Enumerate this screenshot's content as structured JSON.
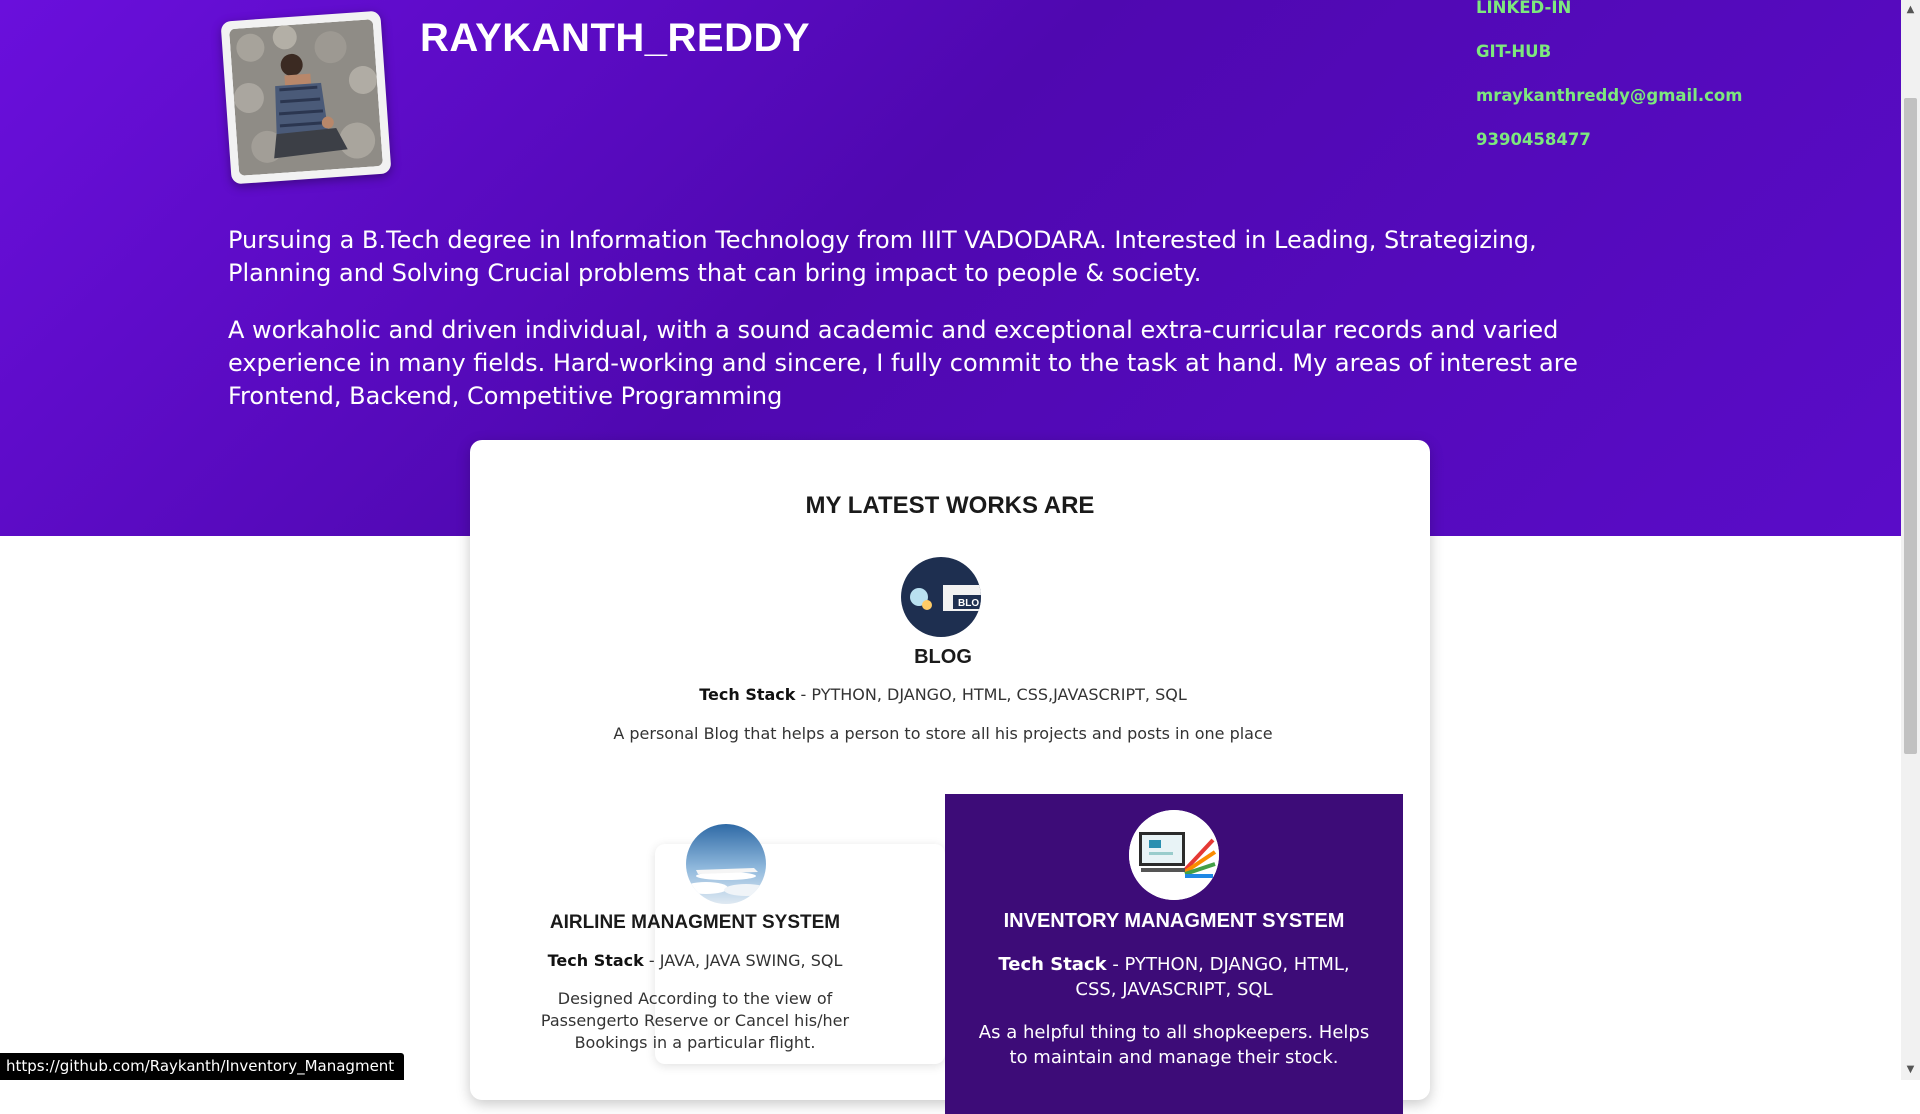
{
  "profile": {
    "name": "RAYKANTH_REDDY",
    "contacts": [
      "LINKED-IN",
      "GIT-HUB",
      "mraykanthreddy@gmail.com",
      "9390458477"
    ],
    "bio": [
      "Pursuing a B.Tech degree in Information Technology from IIIT VADODARA. Interested in Leading, Strategizing, Planning and Solving Crucial problems that can bring impact to people & society.",
      "A workaholic and driven individual, with a sound academic and exceptional extra-curricular records and varied experience in many fields. Hard-working and sincere, I fully commit to the task at hand. My areas of interest are Frontend, Backend, Competitive Programming"
    ]
  },
  "works": {
    "title": "MY LATEST WORKS ARE",
    "stack_label": "Tech Stack",
    "projects": [
      {
        "name": "BLOG",
        "stack": "PYTHON, DJANGO, HTML, CSS,JAVASCRIPT, SQL",
        "description": "A personal Blog that helps a person to store all his projects and posts in one place",
        "icon": "blog-thumbnail-icon",
        "icon_text": "BLO"
      },
      {
        "name": "AIRLINE MANAGMENT SYSTEM",
        "stack": "JAVA, JAVA SWING, SQL",
        "description": "Designed According to the view of Passengerto Reserve or Cancel his/her Bookings in a particular flight.",
        "icon": "airplane-thumbnail-icon"
      },
      {
        "name": "INVENTORY MANAGMENT SYSTEM",
        "stack": "PYTHON, DJANGO, HTML, CSS, JAVASCRIPT, SQL",
        "description": "As a helpful thing to all shopkeepers. Helps to maintain and manage their stock.",
        "icon": "inventory-thumbnail-icon"
      }
    ]
  },
  "status_bar": {
    "url": "https://github.com/Raykanth/Inventory_Managment"
  },
  "colors": {
    "hero_purple": "#5a0cc8",
    "contact_green": "#7de87d",
    "inventory_card": "#3d0c78"
  }
}
